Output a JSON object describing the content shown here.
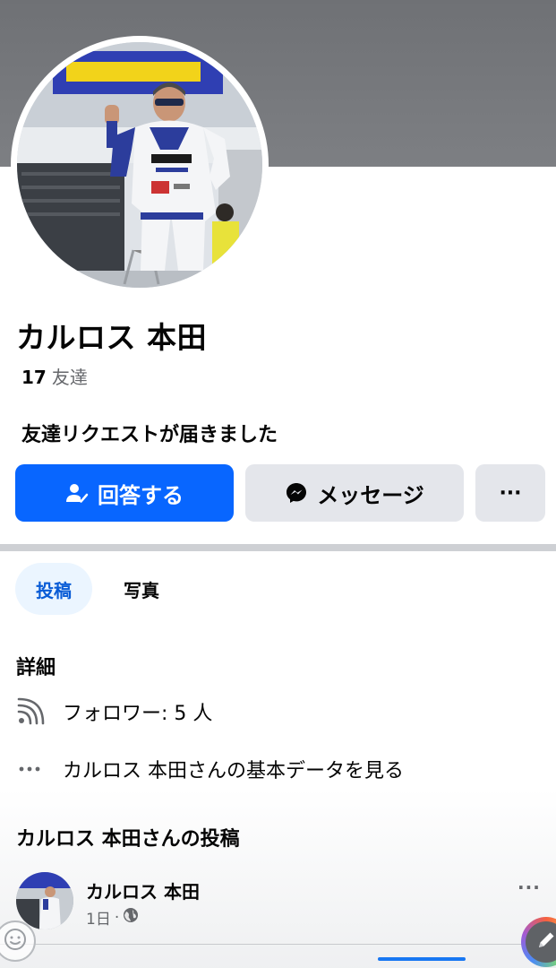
{
  "profile": {
    "name": "カルロス 本田",
    "friends_count": "17",
    "friends_label": "友達",
    "request_text": "友達リクエストが届きました"
  },
  "actions": {
    "respond_label": "回答する",
    "message_label": "メッセージ",
    "more_label": "···"
  },
  "tabs": [
    {
      "label": "投稿",
      "active": true
    },
    {
      "label": "写真",
      "active": false
    }
  ],
  "details": {
    "title": "詳細",
    "followers": "フォロワー: 5 人",
    "basic_info": "カルロス 本田さんの基本データを見る"
  },
  "posts": {
    "title": "カルロス 本田さんの投稿",
    "first_post": {
      "author": "カルロス 本田",
      "time": "1日",
      "separator": "·",
      "privacy_icon": "globe-icon"
    },
    "more_label": "···"
  },
  "colors": {
    "primary": "#0866ff",
    "secondary_button": "#e4e6eb",
    "active_tab_bg": "#ebf5ff",
    "active_tab_text": "#0a5cd6",
    "cover": "#76787c"
  },
  "icons": {
    "respond": "person-check-icon",
    "message": "messenger-icon",
    "followers": "rss-icon",
    "basic_info": "dots-icon",
    "emoji": "emoji-icon",
    "edit": "pencil-icon"
  }
}
